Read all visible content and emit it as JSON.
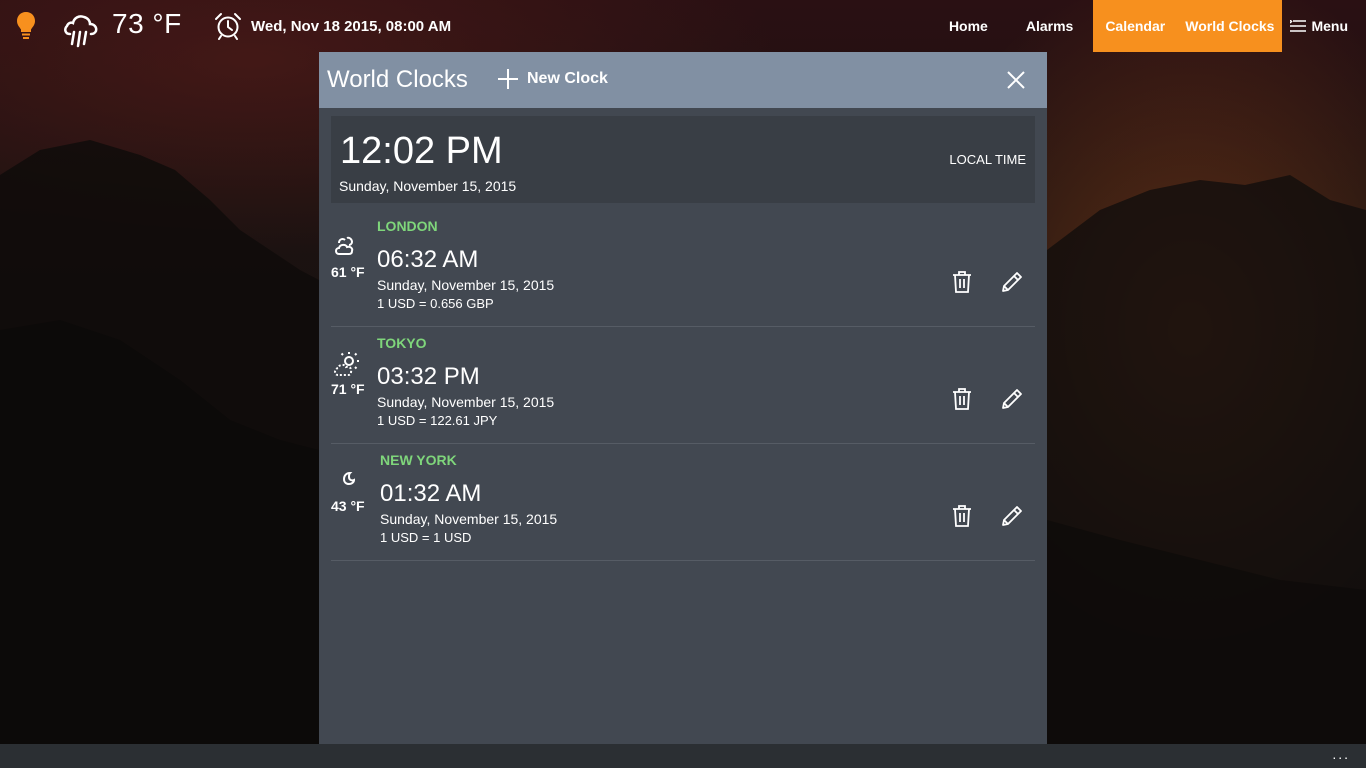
{
  "topbar": {
    "bulb_icon": "lightbulb-icon",
    "weather_icon": "rain-cloud-icon",
    "temperature": "73 °F",
    "alarm_icon": "alarm-clock-icon",
    "datetime": "Wed, Nov 18 2015, 08:00 AM",
    "accent_color": "#f7901e"
  },
  "nav": {
    "home": "Home",
    "alarms": "Alarms",
    "calendar": "Calendar",
    "world_clocks": "World Clocks",
    "menu": "Menu"
  },
  "panel": {
    "title": "World Clocks",
    "new_clock_label": "New Clock",
    "close_icon": "close-icon",
    "header_color": "#8190a3"
  },
  "local": {
    "time": "12:02 PM",
    "date": "Sunday, November 15, 2015",
    "label": "LOCAL TIME"
  },
  "clocks": [
    {
      "city": "LONDON",
      "weather_icon": "partly-cloudy-night-icon",
      "temp": "61 °F",
      "time": "06:32 AM",
      "date": "Sunday, November 15, 2015",
      "currency": "1 USD = 0.656 GBP"
    },
    {
      "city": "TOKYO",
      "weather_icon": "partly-sunny-icon",
      "temp": "71 °F",
      "time": "03:32 PM",
      "date": "Sunday, November 15, 2015",
      "currency": "1 USD = 122.61 JPY"
    },
    {
      "city": "NEW YORK",
      "weather_icon": "moon-icon",
      "temp": "43 °F",
      "time": "01:32 AM",
      "date": "Sunday, November 15, 2015",
      "currency": "1 USD = 1 USD"
    }
  ],
  "bottombar": {
    "more_label": "..."
  }
}
